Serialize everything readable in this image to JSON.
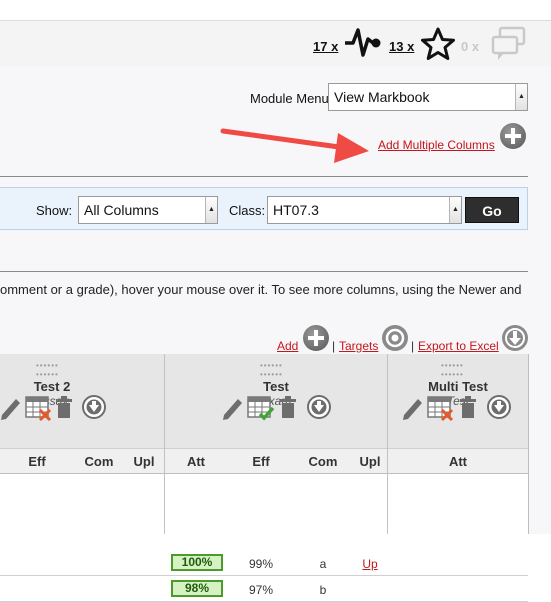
{
  "topbar": {
    "stat1": "17 x",
    "stat2": "13 x",
    "stat3": "0 x"
  },
  "module": {
    "label": "Module Menu",
    "selected": "View Markbook",
    "add_columns": "Add Multiple Columns"
  },
  "filter": {
    "show_label": "Show:",
    "show_value": "All Columns",
    "class_label": "Class:",
    "class_value": "HT07.3",
    "go": "Go"
  },
  "info_text": "omment or a grade), hover your mouse over it. To see more columns, using the Newer and",
  "links": {
    "add": "Add",
    "targets": "Targets",
    "export": "Export to Excel",
    "sep": "|"
  },
  "columns": [
    {
      "title": "Test 2",
      "type": "Essay"
    },
    {
      "title": "Test",
      "type": "Exam"
    },
    {
      "title": "Multi Test",
      "type": "Test"
    }
  ],
  "subheaders": [
    "Eff",
    "Com",
    "Upl",
    "Att",
    "Eff",
    "Com",
    "Upl",
    "Att"
  ],
  "rows": [
    {
      "att": "100%",
      "eff": "99%",
      "com": "a",
      "upl": "Up"
    },
    {
      "att": "98%",
      "eff": "97%",
      "com": "b",
      "upl": ""
    }
  ],
  "colors": {
    "link": "#c4161c",
    "arrow": "#ef4a43",
    "attainment_fill": "#d6f2c4",
    "attainment_border": "#4c9a2a",
    "go_button": "#2e2e2e"
  }
}
